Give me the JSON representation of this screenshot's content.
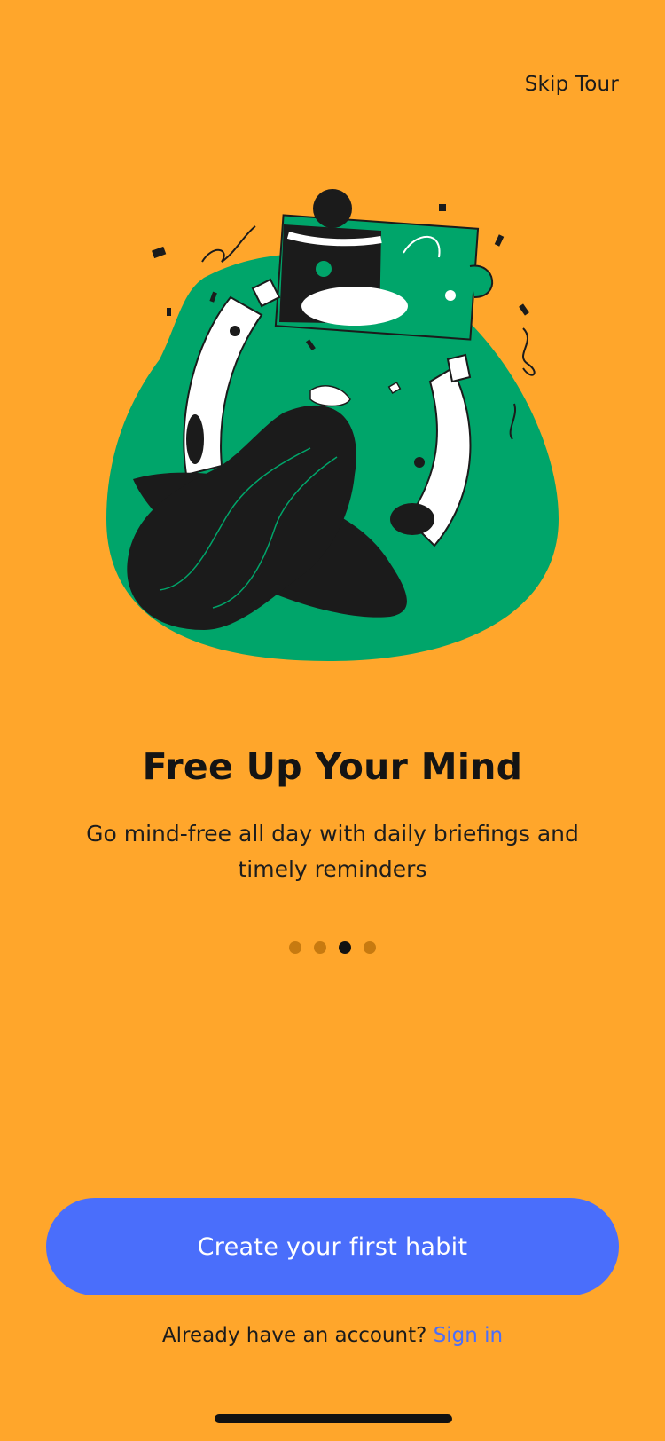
{
  "header": {
    "skip_label": "Skip Tour"
  },
  "illustration": {
    "icon": "person-assembling-puzzle-illustration",
    "colors": {
      "blob": "#00A56A",
      "ink": "#1B1B1B",
      "white": "#FFFFFF"
    }
  },
  "onboarding": {
    "title": "Free Up Your Mind",
    "subtitle": "Go mind-free all day with daily briefings and timely reminders"
  },
  "pagination": {
    "total": 4,
    "active_index": 3
  },
  "actions": {
    "primary_label": "Create your first habit",
    "account_prompt": "Already have an account?",
    "signin_label": "Sign in"
  },
  "theme": {
    "background": "#FFA62B",
    "accent": "#4A6EFB"
  }
}
